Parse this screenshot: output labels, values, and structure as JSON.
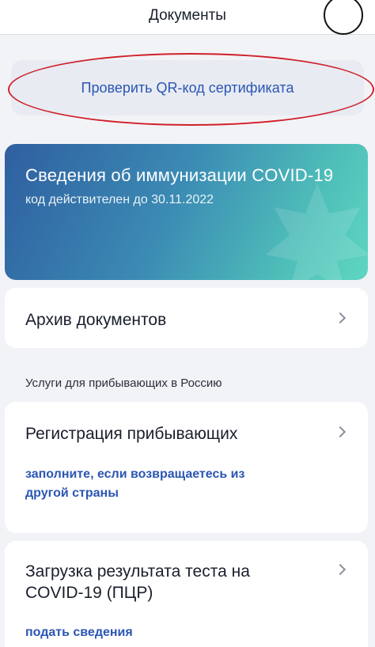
{
  "header": {
    "title": "Документы"
  },
  "qr": {
    "label": "Проверить QR-код сертификата"
  },
  "covid_card": {
    "title": "Сведения об иммунизации COVID-19",
    "subtitle": "код действителен до 30.11.2022",
    "colors": {
      "gradient_start": "#2f5fa0",
      "gradient_end": "#5fd6c2"
    }
  },
  "archive": {
    "title": "Архив документов"
  },
  "section": {
    "label": "Услуги для прибывающих в Россию"
  },
  "registration": {
    "title": "Регистрация прибывающих",
    "link_line1": "заполните, если возвращаетесь из",
    "link_line2": "другой страны"
  },
  "test_upload": {
    "title_line1": "Загрузка результата теста на",
    "title_line2": "COVID-19 (ПЦР)",
    "link": "подать сведения"
  },
  "icons": {
    "chevron": "chevron-right-icon"
  },
  "colors": {
    "accent": "#2b56b3",
    "annotation": "#d1202a",
    "background": "#f2f3f7"
  }
}
